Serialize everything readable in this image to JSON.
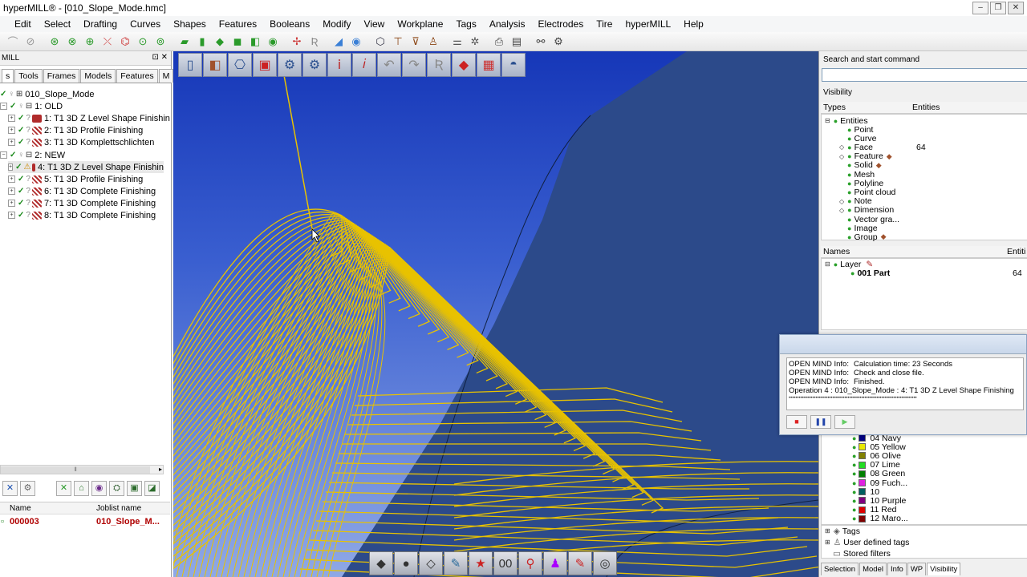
{
  "window": {
    "title": "hyperMILL® - [010_Slope_Mode.hmc]",
    "buttons": [
      "‒",
      "❐",
      "✕"
    ]
  },
  "menu": [
    "Edit",
    "Select",
    "Drafting",
    "Curves",
    "Shapes",
    "Features",
    "Booleans",
    "Modify",
    "View",
    "Workplane",
    "Tags",
    "Analysis",
    "Electrodes",
    "Tire",
    "hyperMILL",
    "Help"
  ],
  "left_panel": {
    "header": "MILL",
    "header_controls": "⊡ ✕",
    "tabs": [
      "s",
      "Tools",
      "Frames",
      "Models",
      "Features",
      "M"
    ],
    "tree": [
      {
        "indent": 0,
        "label": "010_Slope_Mode",
        "kind": "root"
      },
      {
        "indent": 1,
        "label": "1: OLD",
        "kind": "folder"
      },
      {
        "indent": 2,
        "label": "1: T1 3D Z Level Shape Finishin",
        "kind": "op"
      },
      {
        "indent": 2,
        "label": "2: T1 3D Profile Finishing",
        "kind": "op"
      },
      {
        "indent": 2,
        "label": "3: T1 3D Komplettschlichten",
        "kind": "op"
      },
      {
        "indent": 1,
        "label": "2: NEW",
        "kind": "folder"
      },
      {
        "indent": 2,
        "label": "4: T1 3D Z Level Shape Finishin",
        "kind": "op-active"
      },
      {
        "indent": 2,
        "label": "5: T1 3D Profile Finishing",
        "kind": "op"
      },
      {
        "indent": 2,
        "label": "6: T1 3D Complete Finishing",
        "kind": "op"
      },
      {
        "indent": 2,
        "label": "7: T1 3D Complete Finishing",
        "kind": "op"
      },
      {
        "indent": 2,
        "label": "8: T1 3D Complete Finishing",
        "kind": "op"
      }
    ],
    "joblist": {
      "col_name": "Name",
      "col_joblist": "Joblist name",
      "row_name": "000003",
      "row_joblist": "010_Slope_M..."
    }
  },
  "right_panel": {
    "search_label": "Search and start command",
    "visibility_label": "Visibility",
    "types_header": "Types",
    "entities_header": "Entities",
    "entities_root": "Entities",
    "entities": [
      {
        "label": "Point",
        "count": ""
      },
      {
        "label": "Curve",
        "count": ""
      },
      {
        "label": "Face",
        "count": "64"
      },
      {
        "label": "Feature",
        "count": ""
      },
      {
        "label": "Solid",
        "count": ""
      },
      {
        "label": "Mesh",
        "count": ""
      },
      {
        "label": "Polyline",
        "count": ""
      },
      {
        "label": "Point cloud",
        "count": ""
      },
      {
        "label": "Note",
        "count": ""
      },
      {
        "label": "Dimension",
        "count": ""
      },
      {
        "label": "Vector gra...",
        "count": ""
      },
      {
        "label": "Image",
        "count": ""
      },
      {
        "label": "Group",
        "count": ""
      }
    ],
    "names_header": "Names",
    "names_entities_header": "Entiti",
    "layer_label": "Layer",
    "part_label": "001 Part",
    "part_count": "64",
    "colors": [
      {
        "label": "04 Navy",
        "color": "#000080"
      },
      {
        "label": "05 Yellow",
        "color": "#e8e800"
      },
      {
        "label": "06 Olive",
        "color": "#808000"
      },
      {
        "label": "07 Lime",
        "color": "#22dd22"
      },
      {
        "label": "08 Green",
        "color": "#008000"
      },
      {
        "label": "09 Fuch...",
        "color": "#e020e0"
      },
      {
        "label": "10",
        "color": "#006060"
      },
      {
        "label": "10 Purple",
        "color": "#800080"
      },
      {
        "label": "11 Red",
        "color": "#dd0000"
      },
      {
        "label": "12 Maro...",
        "color": "#800000"
      }
    ],
    "tags_label": "Tags",
    "user_tags_label": "User defined tags",
    "stored_filters_label": "Stored filters",
    "tabs": [
      "Selection",
      "Model",
      "Info",
      "WP",
      "Visibility"
    ]
  },
  "info_dialog": {
    "messages": [
      {
        "source": "OPEN MIND Info:",
        "text": "Calculation time: 23 Seconds"
      },
      {
        "source": "OPEN MIND Info:",
        "text": "Check and close file."
      },
      {
        "source": "OPEN MIND Info:",
        "text": "Finished."
      }
    ],
    "operation": "Operation 4 : 010_Slope_Mode : 4: T1 3D Z Level Shape Finishing",
    "progress_dots": "••••••••••••••••••••••••••••••••••••••••••••••••••••••••••••••••••••••••••••"
  },
  "colors": {
    "toolpath": "#e8c200",
    "model_surface": "#2c4a8a",
    "viewport_top": "#1637b8",
    "viewport_bottom": "#8fa8e6",
    "accent_red": "#b00000"
  }
}
